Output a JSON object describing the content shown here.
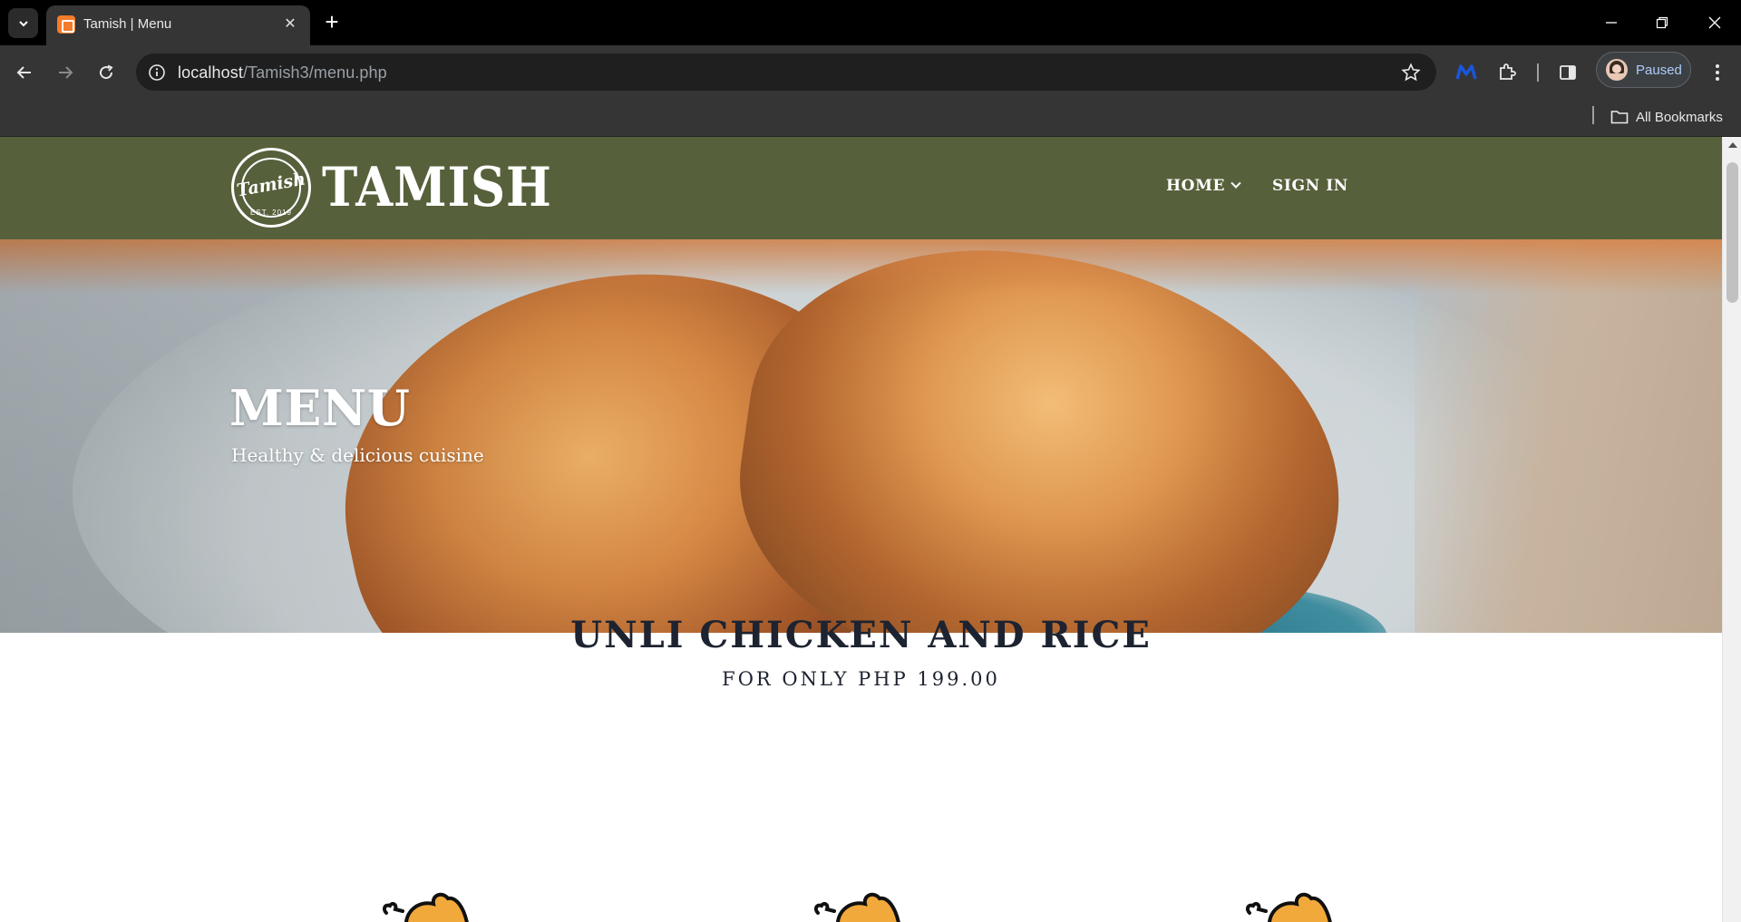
{
  "browser": {
    "tab_title": "Tamish | Menu",
    "url_host": "localhost",
    "url_path": "/Tamish3/menu.php",
    "profile_label": "Paused",
    "bookmarks_label": "All Bookmarks"
  },
  "site": {
    "brand": "TAMISH",
    "seal_script": "Tamish",
    "seal_est": "EST. 2019",
    "nav": [
      {
        "label": "HOME",
        "has_dropdown": true
      },
      {
        "label": "SIGN IN",
        "has_dropdown": false
      }
    ],
    "header_color": "#56603b"
  },
  "hero": {
    "title": "MENU",
    "subtitle": "Healthy & delicious cuisine"
  },
  "promo": {
    "title": "UNLI CHICKEN AND RICE",
    "subtitle": "FOR ONLY PHP 199.00"
  },
  "icons": {
    "menu_items": [
      "chicken-icon",
      "chicken-icon",
      "chicken-icon"
    ]
  }
}
